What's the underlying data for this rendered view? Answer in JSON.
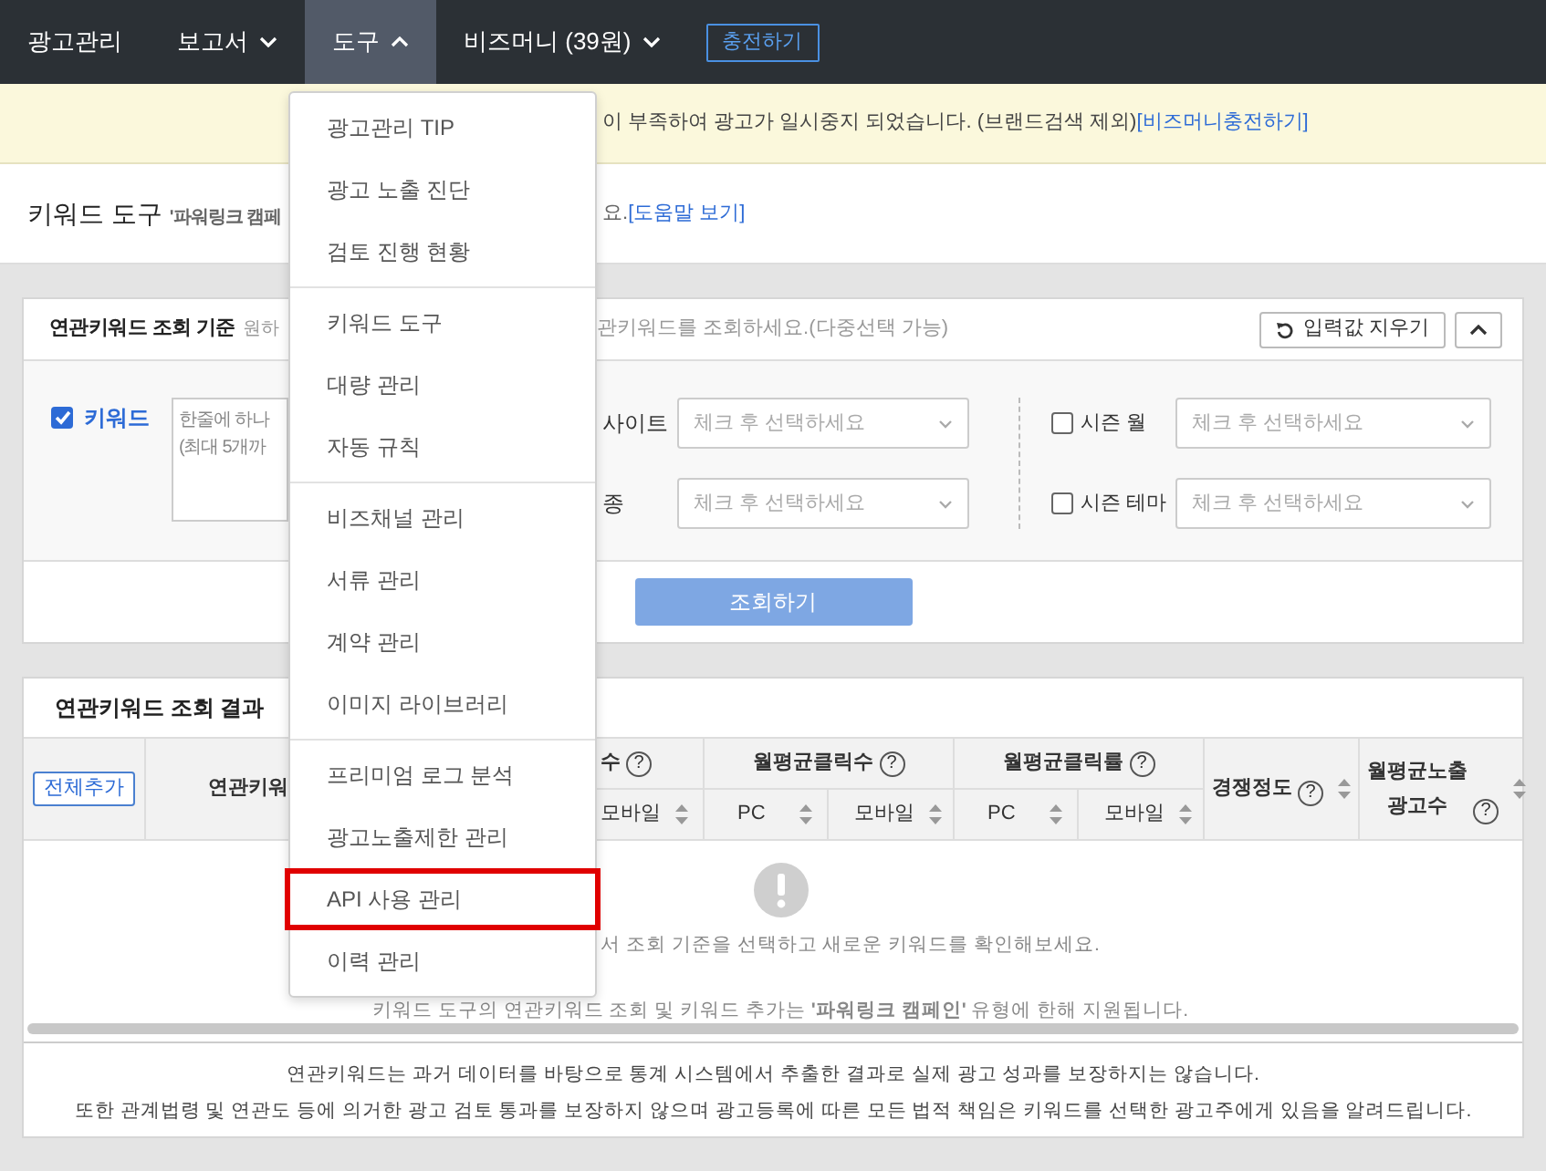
{
  "nav": {
    "items": [
      {
        "label": "광고관리",
        "selected": false,
        "dropdown": false
      },
      {
        "label": "보고서",
        "selected": false,
        "dropdown": true,
        "expanded": false
      },
      {
        "label": "도구",
        "selected": true,
        "dropdown": true,
        "expanded": true
      },
      {
        "label": "비즈머니 (39원)",
        "selected": false,
        "dropdown": true,
        "expanded": false
      }
    ],
    "charge_button": "충전하기"
  },
  "notice": {
    "text": "이 부족하여 광고가 일시중지 되었습니다. (브랜드검색 제외)",
    "link": "[비즈머니충전하기]"
  },
  "page_header": {
    "title": "키워드 도구",
    "subtitle": "'파워링크 캠페",
    "subtitle_end": "요.",
    "help_link": "[도움말 보기]"
  },
  "criteria": {
    "title": "연관키워드 조회 기준",
    "hint_start": "원하",
    "hint_end": "관키워드를 조회하세요.(다중선택 가능)",
    "reset_button": "입력값 지우기",
    "keyword": {
      "label": "키워드",
      "checked": true,
      "placeholder": "한줄에 하나\n(최대 5개까"
    },
    "filters_left": [
      {
        "label": "사이트",
        "placeholder": "체크 후 선택하세요"
      },
      {
        "label": "종",
        "placeholder": "체크 후 선택하세요"
      }
    ],
    "filters_right": [
      {
        "label": "시즌 월",
        "checked": false,
        "placeholder": "체크 후 선택하세요"
      },
      {
        "label": "시즌 테마",
        "checked": false,
        "placeholder": "체크 후 선택하세요"
      }
    ],
    "search_button": "조회하기"
  },
  "results": {
    "title": "연관키워드 조회 결과",
    "add_all_button": "전체추가",
    "keyword_column": "연관키워",
    "groups": [
      {
        "label": "수",
        "help": "?",
        "subcolumns": [
          "모바일"
        ]
      },
      {
        "label": "월평균클릭수",
        "help": "?",
        "subcolumns": [
          "PC",
          "모바일"
        ]
      },
      {
        "label": "월평균클릭률",
        "help": "?",
        "subcolumns": [
          "PC",
          "모바일"
        ]
      }
    ],
    "columns": [
      {
        "label": "경쟁정도",
        "help": "?"
      },
      {
        "label": "월평균노출\n광고수",
        "help": "?"
      }
    ],
    "empty_message": "서 조회 기준을 선택하고 새로운 키워드를 확인해보세요.",
    "support_note": "키워드 도구의 연관키워드 조회 및 키워드 추가는 **'파워링크 캠페인'** 유형에 한해 지원됩니다.",
    "disclaimer": [
      "연관키워드는 과거 데이터를 바탕으로 통계 시스템에서 추출한 결과로 실제 광고 성과를 보장하지는 않습니다.",
      "또한 관계법령 및 연관도 등에 의거한 광고 검토 통과를 보장하지 않으며 광고등록에 따른 모든 법적 책임은 키워드를 선택한 광고주에게 있음을 알려드립니다."
    ]
  },
  "tools_menu": {
    "groups": [
      {
        "items": [
          {
            "label": "광고관리 TIP",
            "highlighted": false
          },
          {
            "label": "광고 노출 진단",
            "highlighted": false
          },
          {
            "label": "검토 진행 현황",
            "highlighted": false
          }
        ]
      },
      {
        "items": [
          {
            "label": "키워드 도구",
            "highlighted": false
          },
          {
            "label": "대량 관리",
            "highlighted": false
          },
          {
            "label": "자동 규칙",
            "highlighted": false
          }
        ]
      },
      {
        "items": [
          {
            "label": "비즈채널 관리",
            "highlighted": false
          },
          {
            "label": "서류 관리",
            "highlighted": false
          },
          {
            "label": "계약 관리",
            "highlighted": false
          },
          {
            "label": "이미지 라이브러리",
            "highlighted": false
          }
        ]
      },
      {
        "items": [
          {
            "label": "프리미엄 로그 분석",
            "highlighted": false
          },
          {
            "label": "광고노출제한 관리",
            "highlighted": false
          },
          {
            "label": "API 사용 관리",
            "highlighted": true
          },
          {
            "label": "이력 관리",
            "highlighted": false
          }
        ]
      }
    ]
  }
}
